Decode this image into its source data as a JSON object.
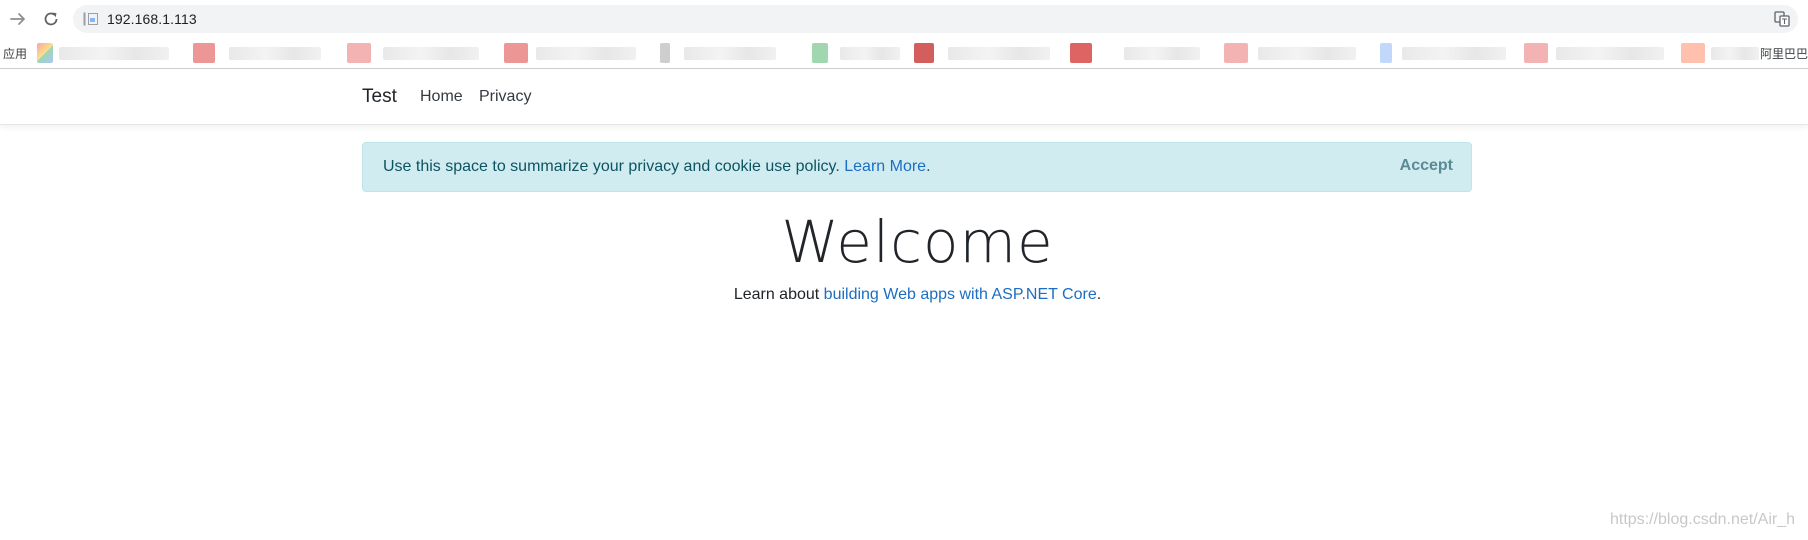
{
  "browser": {
    "url": "192.168.1.113",
    "bookmarks_apps_label": "应用",
    "bookmarks_right_label": "阿里巴巴"
  },
  "navbar": {
    "brand": "Test",
    "links": [
      "Home",
      "Privacy"
    ]
  },
  "cookie_alert": {
    "message": "Use this space to summarize your privacy and cookie use policy.",
    "link_text": "Learn More",
    "link_suffix": ".",
    "accept_label": "Accept"
  },
  "main": {
    "heading": "Welcome",
    "intro_prefix": "Learn about ",
    "intro_link": "building Web apps with ASP.NET Core",
    "intro_suffix": "."
  },
  "watermark": "https://blog.csdn.net/Air_h",
  "colors": {
    "alert_bg": "#d1ecf1",
    "link": "#1b6ec2"
  }
}
